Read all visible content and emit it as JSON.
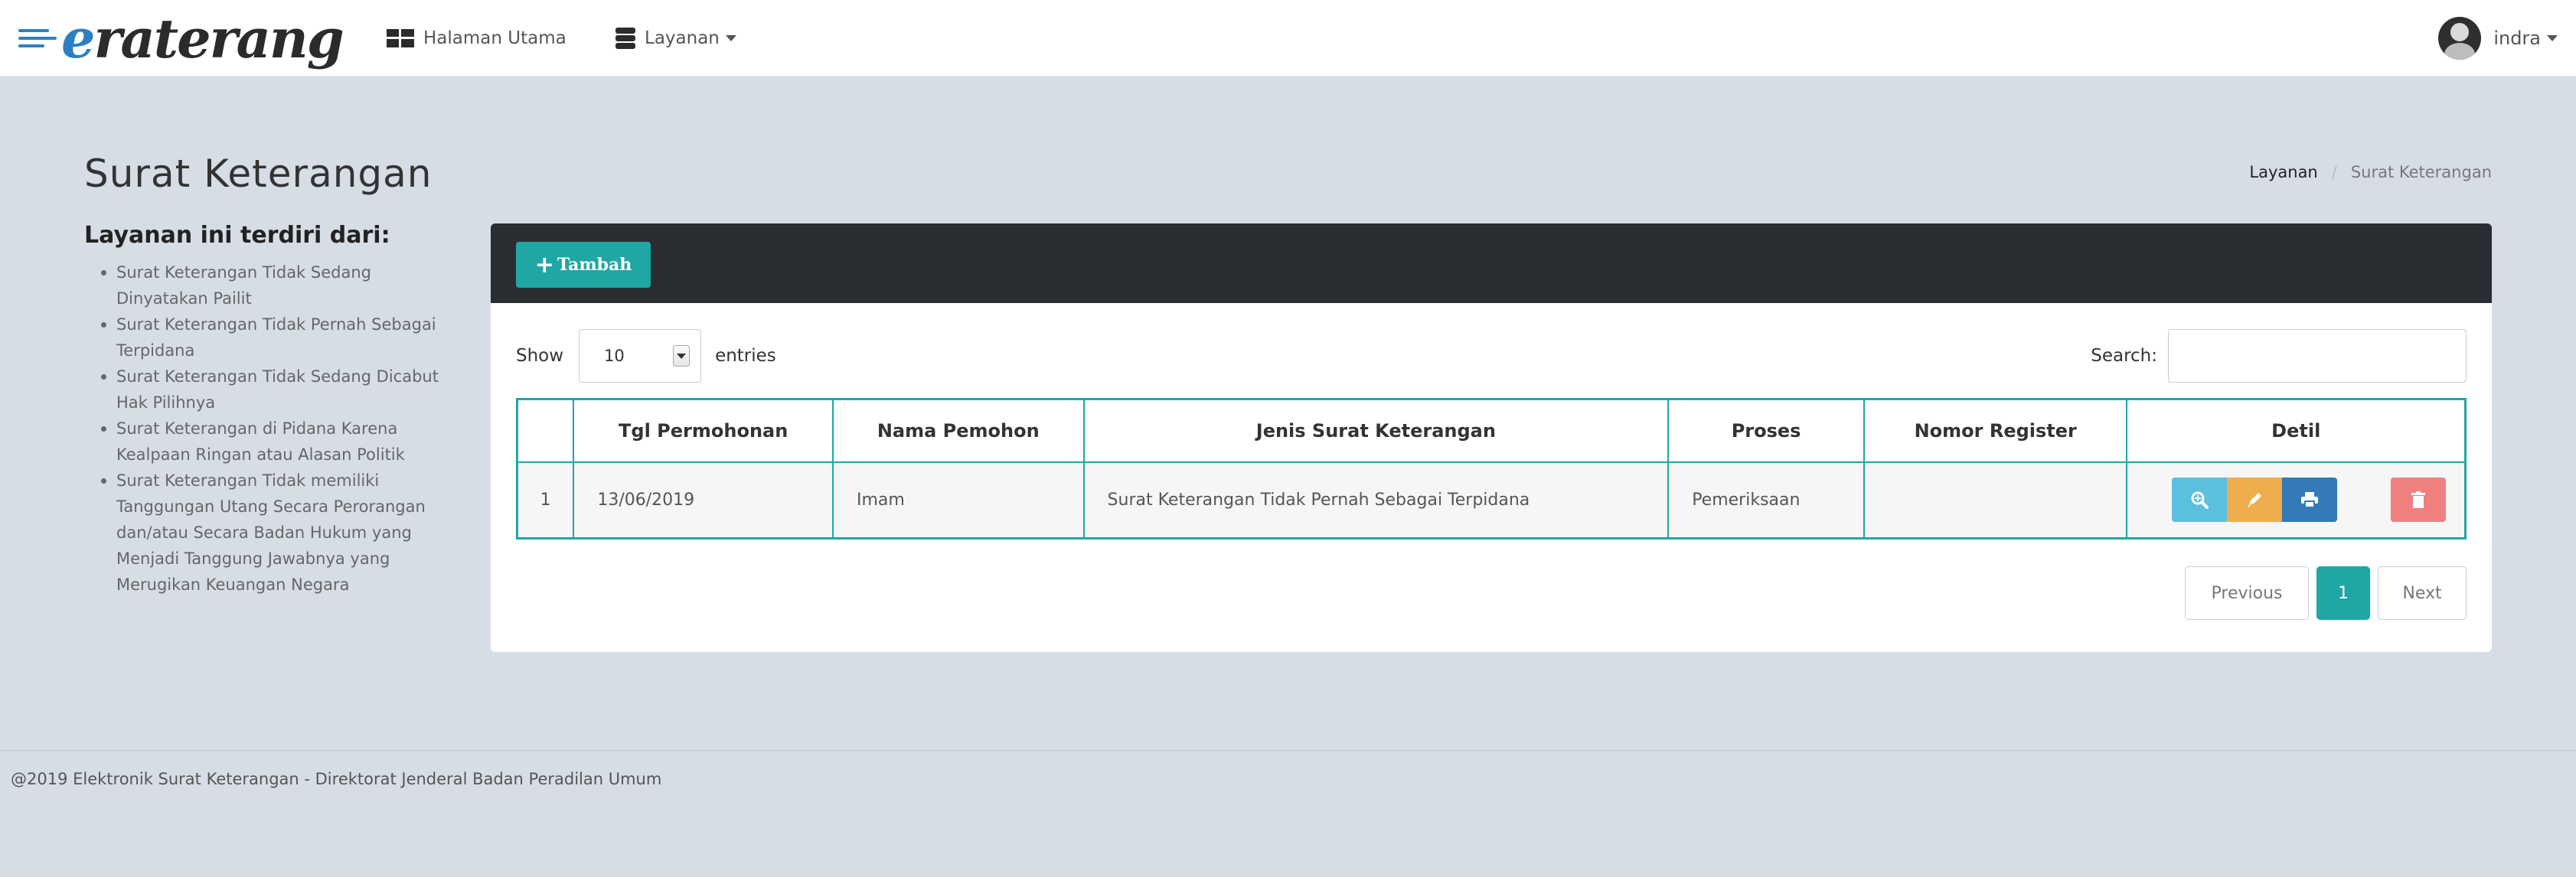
{
  "brand": {
    "name": "eraterang"
  },
  "nav": {
    "home_label": "Halaman Utama",
    "home_icon": "grid-icon",
    "services_label": "Layanan",
    "services_icon": "database-icon"
  },
  "user": {
    "name": "indra"
  },
  "page": {
    "title": "Surat Keterangan"
  },
  "breadcrumb": {
    "parent": "Layanan",
    "separator": "/",
    "current": "Surat Keterangan"
  },
  "sidebar": {
    "heading": "Layanan ini terdiri dari:",
    "items": [
      "Surat Keterangan Tidak Sedang Dinyatakan Pailit",
      "Surat Keterangan Tidak Pernah Sebagai Terpidana",
      "Surat Keterangan Tidak Sedang Dicabut Hak Pilihnya",
      "Surat Keterangan di Pidana Karena Kealpaan Ringan atau Alasan Politik",
      "Surat Keterangan Tidak memiliki Tanggungan Utang Secara Perorangan dan/atau Secara Badan Hukum yang Menjadi Tanggung Jawabnya yang Merugikan Keuangan Negara"
    ]
  },
  "toolbar": {
    "add_label": "Tambah"
  },
  "datatable": {
    "show_label": "Show",
    "entries_value": "10",
    "entries_label": "entries",
    "search_label": "Search:",
    "search_value": "",
    "columns": [
      "",
      "Tgl Permohonan",
      "Nama Pemohon",
      "Jenis Surat Keterangan",
      "Proses",
      "Nomor Register",
      "Detil"
    ],
    "rows": [
      {
        "no": "1",
        "tgl": "13/06/2019",
        "nama": "Imam",
        "jenis": "Surat Keterangan Tidak Pernah Sebagai Terpidana",
        "proses": "Pemeriksaan",
        "nomor": ""
      }
    ]
  },
  "pagination": {
    "previous": "Previous",
    "current": "1",
    "next": "Next"
  },
  "footer": {
    "text": "@2019 Elektronik Surat Keterangan - Direktorat Jenderal Badan Peradilan Umum"
  },
  "colors": {
    "accent": "#1fa7a5",
    "brand_blue": "#2d7fc3",
    "panel_header": "#2a2e33",
    "view": "#5bc0de",
    "edit": "#f0ad4e",
    "print": "#337ab7",
    "delete": "#f08080"
  }
}
